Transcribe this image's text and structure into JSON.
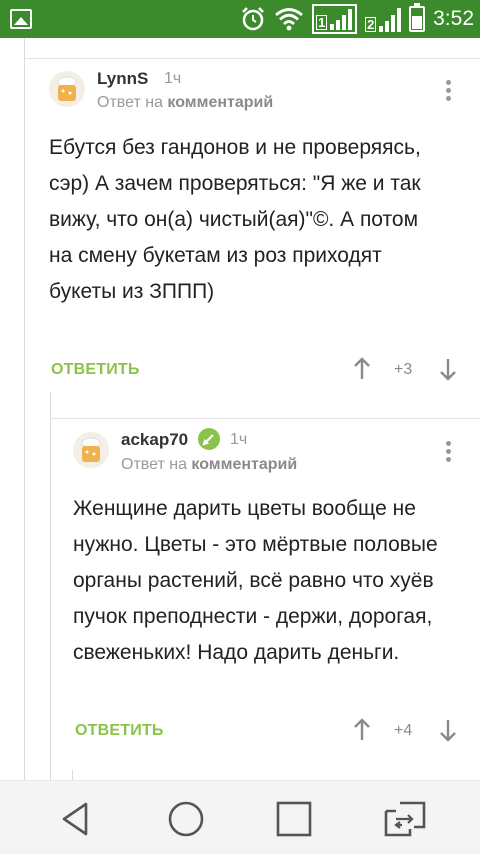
{
  "status_bar": {
    "time": "3:52",
    "signal1_label": "1",
    "signal2_label": "2"
  },
  "comments": [
    {
      "username": "LynnS",
      "time": "1ч",
      "reply_prefix": "Ответ на",
      "reply_target": "комментарий",
      "text": "Ебутся без гандонов и не проверяясь, сэр) А зачем проверяться: \"Я же и так вижу, что он(а) чистый(ая)\"©. А потом на смену букетам из роз приходят букеты из ЗППП)",
      "reply_label": "ОТВЕТИТЬ",
      "score": "+3"
    },
    {
      "username": "ackap70",
      "time": "1ч",
      "reply_prefix": "Ответ на",
      "reply_target": "комментарий",
      "text": "Женщине дарить цветы вообще не нужно. Цветы - это мёртвые половые органы растений, всё равно что хуёв пучок преподнести - держи, дорогая, свеженьких! Надо дарить деньги.",
      "reply_label": "ОТВЕТИТЬ",
      "score": "+4"
    }
  ],
  "icons": {
    "status": [
      "image-icon",
      "alarm-icon",
      "wifi-icon",
      "signal-icon",
      "battery-icon"
    ],
    "nav": [
      "back-icon",
      "home-icon",
      "recents-icon",
      "switch-icon"
    ]
  },
  "colors": {
    "status_bar": "#3b8a2c",
    "accent": "#8bc34a"
  }
}
